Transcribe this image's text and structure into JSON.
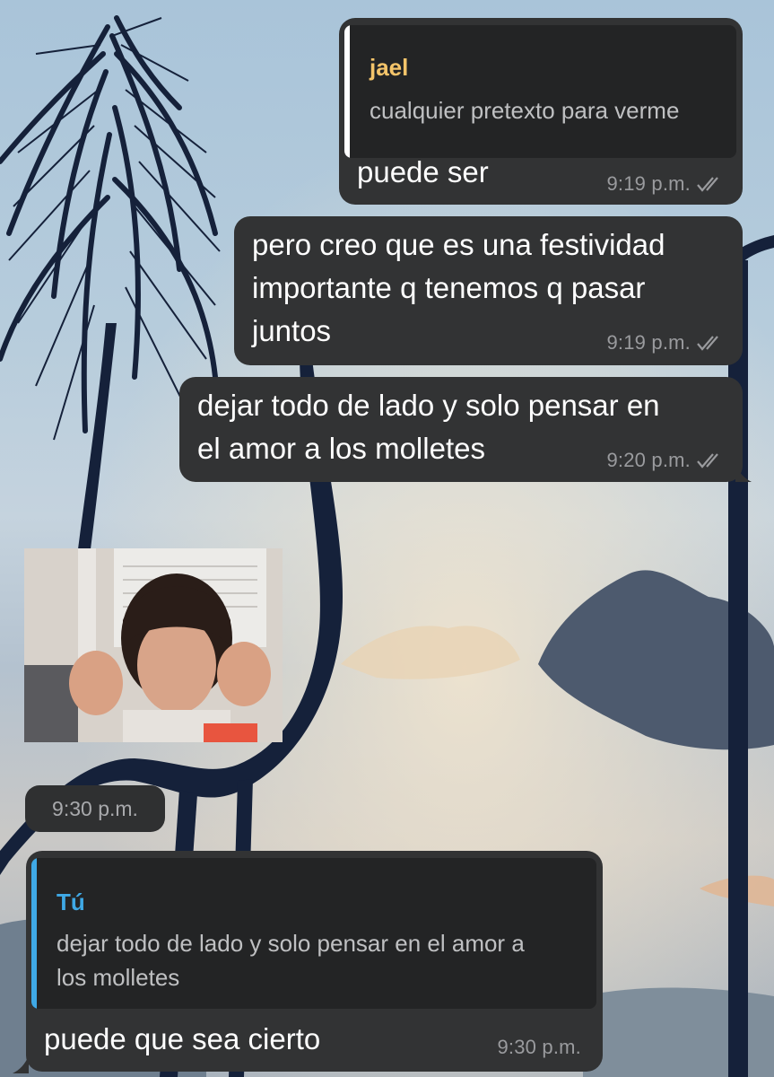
{
  "messages": [
    {
      "quote": {
        "author": "jael",
        "text": "cualquier pretexto para verme"
      },
      "text": "puede ser",
      "time": "9:19 p.m."
    },
    {
      "text": "pero creo que es una festividad\nimportante q tenemos q pasar\njuntos",
      "time": "9:19 p.m."
    },
    {
      "text": "dejar todo de lado y solo pensar en\nel amor a los molletes",
      "time": "9:20 p.m."
    }
  ],
  "sticker": {
    "time": "9:30 p.m."
  },
  "reply": {
    "quote": {
      "author": "Tú",
      "text": "dejar todo de lado y solo pensar en el amor a\nlos molletes"
    },
    "text": "puede que sea cierto",
    "time": "9:30 p.m."
  },
  "colors": {
    "bubble": "#323334",
    "quote_author_outgoing": "#f4c46a",
    "quote_author_incoming": "#3fa9e6",
    "ticks": "#9a9b9e"
  }
}
